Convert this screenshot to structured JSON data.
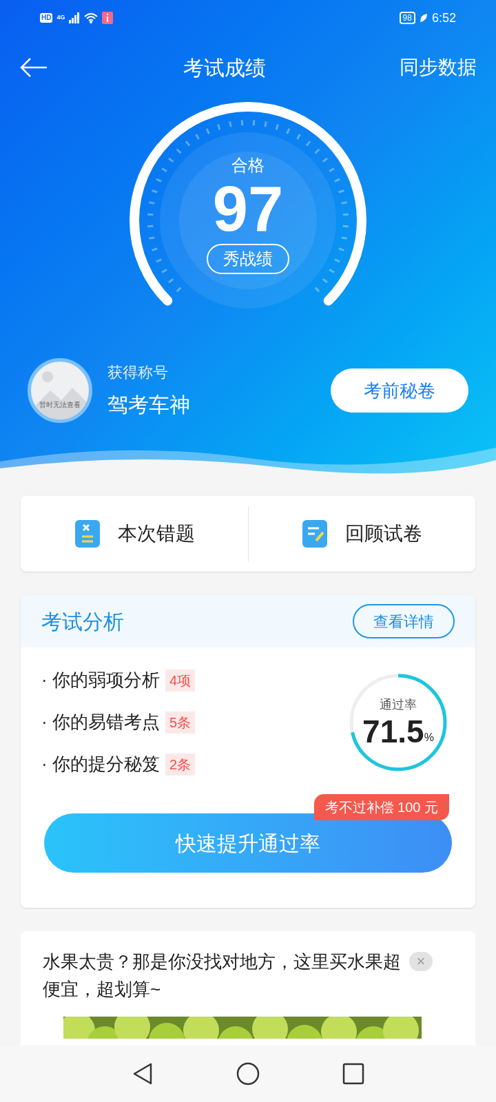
{
  "status_bar": {
    "hd": "HD",
    "network": "4G",
    "battery": "98",
    "time": "6:52"
  },
  "header": {
    "title": "考试成绩",
    "action": "同步数据"
  },
  "score": {
    "status": "合格",
    "value": "97",
    "share_button": "秀战绩"
  },
  "title_card": {
    "avatar_caption": "暂时无法查看",
    "label": "获得称号",
    "title": "驾考车神",
    "button": "考前秘卷"
  },
  "quick_actions": [
    {
      "kind": "wrong",
      "label": "本次错题"
    },
    {
      "kind": "review",
      "label": "回顾试卷"
    }
  ],
  "analysis": {
    "title": "考试分析",
    "details_button": "查看详情",
    "items": [
      {
        "label": "· 你的弱项分析",
        "badge": "4项"
      },
      {
        "label": "· 你的易错考点",
        "badge": "5条"
      },
      {
        "label": "· 你的提分秘笈",
        "badge": "2条"
      }
    ],
    "pass_rate": {
      "label": "通过率",
      "value": "71.5",
      "unit": "%"
    },
    "promo_tag": "考不过补偿 100 元",
    "cta": "快速提升通过率"
  },
  "ad": {
    "text": "水果太贵？那是你没找对地方，这里买水果超便宜，超划算~",
    "close": "×"
  }
}
